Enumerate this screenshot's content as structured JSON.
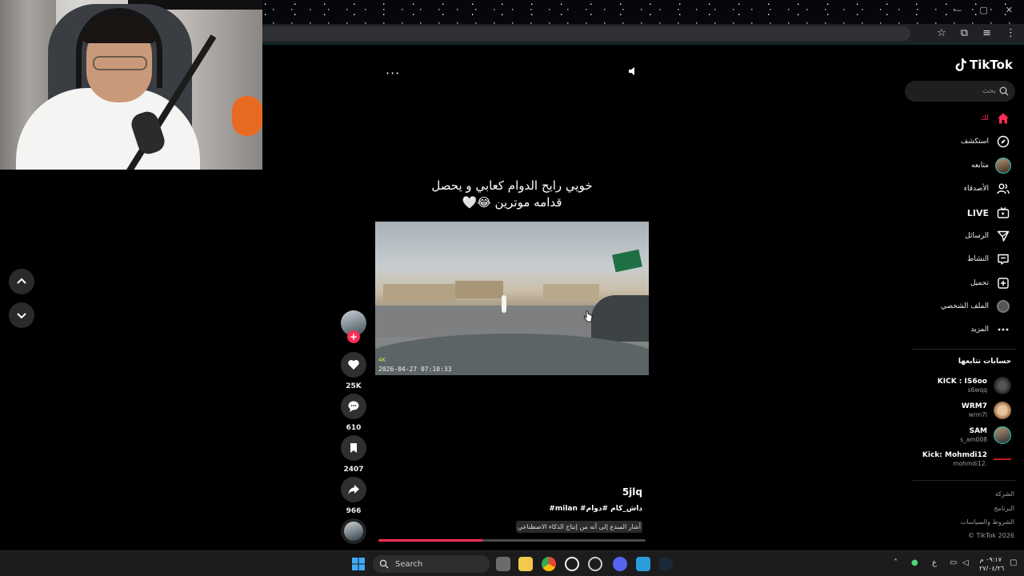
{
  "video": {
    "caption_line1": "خويي رايح الدوام كعابي و يحصل",
    "caption_line2": "قدامه موترين 😂🤍",
    "timestamp": "2026-04-27 07:10:33",
    "quality_badge": "4K",
    "author": "5jlq",
    "hashtags": "#milan #داش_كام #دوام",
    "ai_label": "أشار المبدع إلى أنه من إنتاج الذكاء الاصطناعي",
    "more_label": "···",
    "progress": 0.39
  },
  "actions": {
    "follow_label": "+",
    "likes": "25K",
    "comments": "610",
    "saves": "2407",
    "shares": "966"
  },
  "sidebar": {
    "logo": "TikTok",
    "search_placeholder": "بحث",
    "menu": [
      {
        "label": "لك",
        "icon": "home-icon",
        "active": true
      },
      {
        "label": "استكشف",
        "icon": "compass-icon"
      },
      {
        "label": "متابعه",
        "icon": "following-avatar-icon"
      },
      {
        "label": "الأصدقاء",
        "icon": "friends-icon"
      },
      {
        "label": "LIVE",
        "icon": "live-icon"
      },
      {
        "label": "الرسائل",
        "icon": "send-icon"
      },
      {
        "label": "النشاط",
        "icon": "activity-icon"
      },
      {
        "label": "تحميل",
        "icon": "upload-icon"
      },
      {
        "label": "الملف الشخصي",
        "icon": "profile-icon"
      },
      {
        "label": "المزيد",
        "icon": "more-icon"
      }
    ],
    "following_title": "حسابات تتابعها",
    "following": [
      {
        "name": "KICK : IS6oo",
        "handle": "s6wqq"
      },
      {
        "name": "WRM7",
        "handle": "wrm7l"
      },
      {
        "name": "SAM",
        "handle": "s_am008"
      },
      {
        "name": "Kick: Mohmdi12",
        "handle": "mohmdi12."
      }
    ],
    "footer": [
      "الشركة",
      "البرنامج",
      "الشروط والسياسات",
      "TikTok 2026 ©"
    ]
  },
  "taskbar": {
    "search_label": "Search",
    "time": "٠٩:١٧ م",
    "date": "٢٧/٠٤/٢٦",
    "lang": "ع"
  },
  "colors": {
    "accent": "#fe2c55",
    "background": "#000000"
  }
}
